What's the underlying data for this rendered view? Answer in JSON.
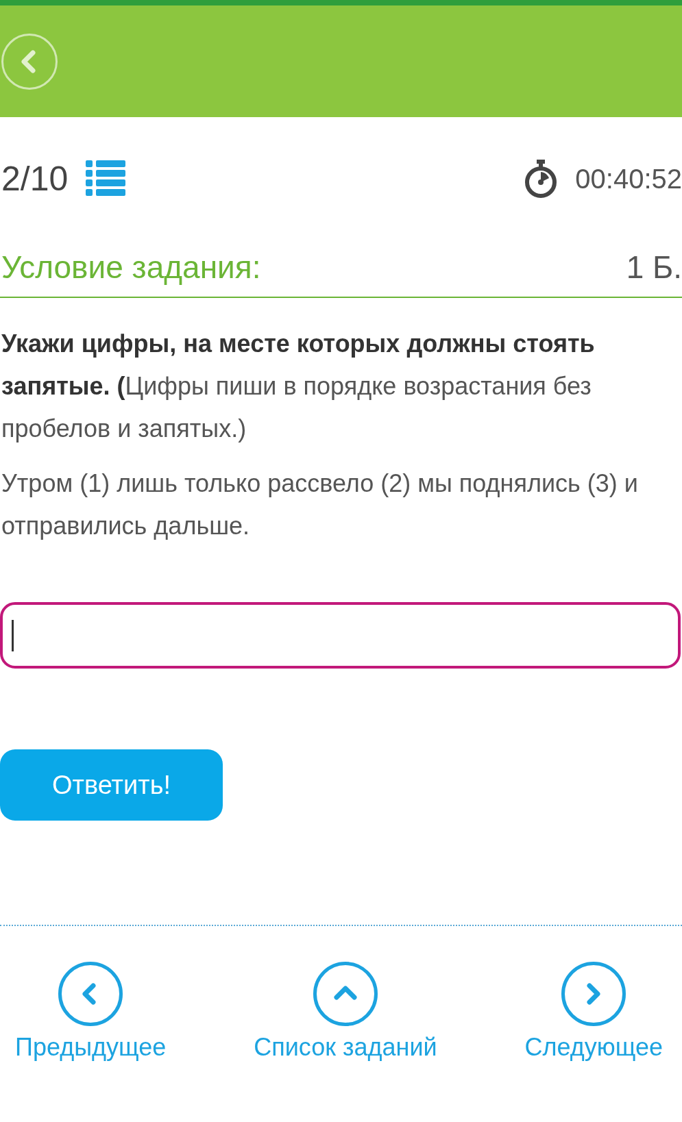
{
  "progress": {
    "counter": "2/10"
  },
  "timer": {
    "time": "00:40:52"
  },
  "task": {
    "heading": "Условие задания:",
    "points": "1 Б.",
    "instruction": "**Укажи цифры, на месте которых должны стоять запятые. (**Цифры пиши в порядке возрастания без пробелов и запятых.)",
    "sentence": "Утром (1) лишь только рассвело (2) мы поднялись (3) и отправились дальше."
  },
  "answer": {
    "focused": true
  },
  "submit": "Ответить!",
  "nav": [
    {
      "label": "Предыдущее",
      "kind": "prev"
    },
    {
      "label": "Список заданий",
      "kind": "list"
    },
    {
      "label": "Следующее",
      "kind": "next"
    }
  ]
}
